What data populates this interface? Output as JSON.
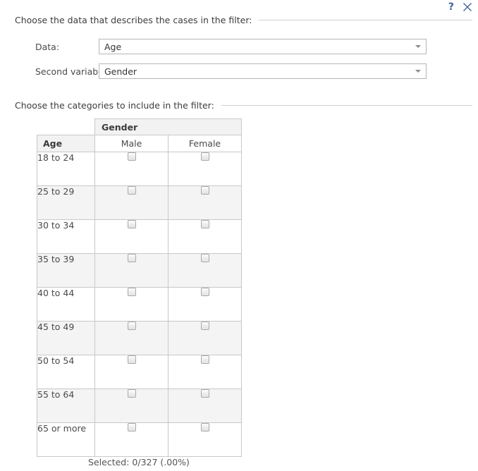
{
  "window": {
    "help_label": "?",
    "help_icon": "question-mark-icon",
    "close_icon": "close-x-icon",
    "accent_color": "#44659c"
  },
  "sections": {
    "data_section": {
      "title": "Choose the data that describes the cases in the filter:"
    },
    "categories_section": {
      "title": "Choose the categories to include in the filter:"
    }
  },
  "form": {
    "data_row": {
      "label": "Data:",
      "value": "Age",
      "arrow_icon": "chevron-down-icon"
    },
    "second_row": {
      "label": "Second variable:",
      "value": "Gender",
      "arrow_icon": "chevron-down-icon"
    }
  },
  "table": {
    "group_header": "Gender",
    "row_header": "Age",
    "columns": [
      "Male",
      "Female"
    ],
    "rows": [
      {
        "label": "18 to 24",
        "male_checked": false,
        "female_checked": false
      },
      {
        "label": "25 to 29",
        "male_checked": false,
        "female_checked": false
      },
      {
        "label": "30 to 34",
        "male_checked": false,
        "female_checked": false
      },
      {
        "label": "35 to 39",
        "male_checked": false,
        "female_checked": false
      },
      {
        "label": "40 to 44",
        "male_checked": false,
        "female_checked": false
      },
      {
        "label": "45 to 49",
        "male_checked": false,
        "female_checked": false
      },
      {
        "label": "50 to 54",
        "male_checked": false,
        "female_checked": false
      },
      {
        "label": "55 to 64",
        "male_checked": false,
        "female_checked": false
      },
      {
        "label": "65 or more",
        "male_checked": false,
        "female_checked": false
      }
    ]
  },
  "footer": {
    "selected_status": "Selected: 0/327 (.00%)"
  }
}
